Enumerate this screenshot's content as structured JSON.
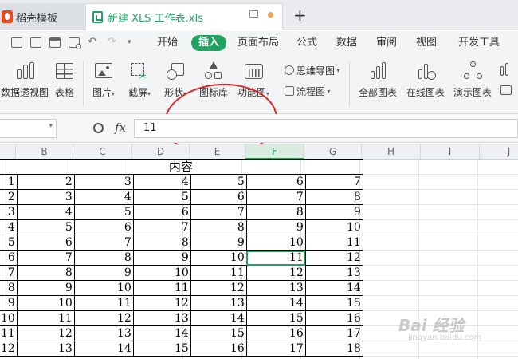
{
  "tabs": {
    "template_tab": "稻壳模板",
    "file_tab": "新建 XLS 工作表.xls",
    "new_tab_glyph": "+"
  },
  "ribbon_tabs": [
    "开始",
    "插入",
    "页面布局",
    "公式",
    "数据",
    "审阅",
    "视图",
    "开发工具"
  ],
  "active_tab": "插入",
  "ribbon": {
    "pivot": "数据透视图",
    "table": "表格",
    "picture": "图片",
    "screenshot": "截屏",
    "shape": "形状",
    "icon_library": "图标库",
    "function_chart": "功能图",
    "mind_map": "思维导图",
    "flowchart": "流程图",
    "all_charts": "全部图表",
    "online_charts": "在线图表",
    "demo_charts": "演示图表"
  },
  "formula_bar": {
    "fx": "fx",
    "value": "11"
  },
  "columns": [
    "B",
    "C",
    "D",
    "E",
    "F",
    "G",
    "H",
    "I",
    "J"
  ],
  "selected_column": "F",
  "sheet": {
    "title": "内容",
    "rows": [
      [
        "1",
        "2",
        "3",
        "4",
        "5",
        "6",
        "7"
      ],
      [
        "2",
        "3",
        "4",
        "5",
        "6",
        "7",
        "8"
      ],
      [
        "3",
        "4",
        "5",
        "6",
        "7",
        "8",
        "9"
      ],
      [
        "4",
        "5",
        "6",
        "7",
        "8",
        "9",
        "10"
      ],
      [
        "5",
        "6",
        "7",
        "8",
        "9",
        "10",
        "11"
      ],
      [
        "6",
        "7",
        "8",
        "9",
        "10",
        "11",
        "12"
      ],
      [
        "7",
        "8",
        "9",
        "10",
        "11",
        "12",
        "13"
      ],
      [
        "8",
        "9",
        "10",
        "11",
        "12",
        "13",
        "14"
      ],
      [
        "9",
        "10",
        "11",
        "12",
        "13",
        "14",
        "15"
      ],
      [
        "10",
        "11",
        "12",
        "13",
        "14",
        "15",
        "16"
      ],
      [
        "11",
        "12",
        "13",
        "14",
        "15",
        "16",
        "17"
      ],
      [
        "12",
        "13",
        "14",
        "15",
        "16",
        "17",
        "18"
      ]
    ],
    "selected_cell": [
      5,
      5
    ]
  },
  "watermark": {
    "brand": "Bai 经验",
    "url": "jingyan.baidu.com"
  },
  "colors": {
    "accent": "#22a262",
    "annotation": "#e0232a"
  }
}
